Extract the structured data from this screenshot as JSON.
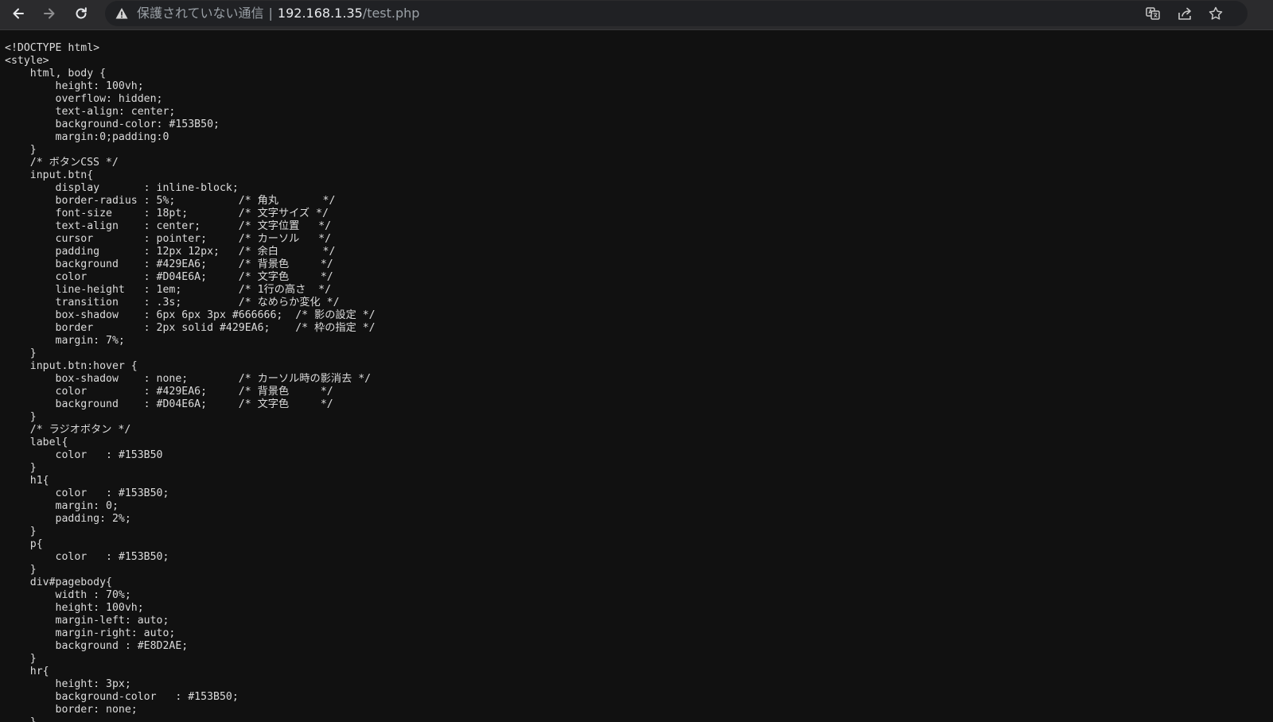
{
  "browser": {
    "security_label": "保護されていない通信",
    "separator": "|",
    "url_host": "192.168.1.35",
    "url_path": "/test.php",
    "icons": {
      "back": "back-arrow-icon",
      "forward": "forward-arrow-icon",
      "reload": "reload-icon",
      "warning": "warning-triangle-icon",
      "translate": "translate-icon",
      "share": "share-icon",
      "bookmark": "star-icon"
    }
  },
  "page": {
    "source_text": "<!DOCTYPE html>\n<style>\n    html, body {\n        height: 100vh;\n        overflow: hidden;\n        text-align: center;\n        background-color: #153B50;\n        margin:0;padding:0\n    }\n    /* ボタンCSS */\n    input.btn{\n        display       : inline-block;\n        border-radius : 5%;          /* 角丸       */\n        font-size     : 18pt;        /* 文字サイズ */\n        text-align    : center;      /* 文字位置   */\n        cursor        : pointer;     /* カーソル   */\n        padding       : 12px 12px;   /* 余白       */\n        background    : #429EA6;     /* 背景色     */\n        color         : #D04E6A;     /* 文字色     */\n        line-height   : 1em;         /* 1行の高さ  */\n        transition    : .3s;         /* なめらか変化 */\n        box-shadow    : 6px 6px 3px #666666;  /* 影の設定 */\n        border        : 2px solid #429EA6;    /* 枠の指定 */\n        margin: 7%;\n    }\n    input.btn:hover {\n        box-shadow    : none;        /* カーソル時の影消去 */\n        color         : #429EA6;     /* 背景色     */\n        background    : #D04E6A;     /* 文字色     */\n    }\n    /* ラジオボタン */\n    label{\n        color   : #153B50\n    }\n    h1{\n        color   : #153B50;\n        margin: 0;\n        padding: 2%;\n    }\n    p{\n        color   : #153B50;\n    }\n    div#pagebody{\n        width : 70%;\n        height: 100vh;\n        margin-left: auto;\n        margin-right: auto;\n        background : #E8D2AE;\n    }\n    hr{\n        height: 3px;\n        background-color   : #153B50;\n        border: none;\n    }"
  }
}
